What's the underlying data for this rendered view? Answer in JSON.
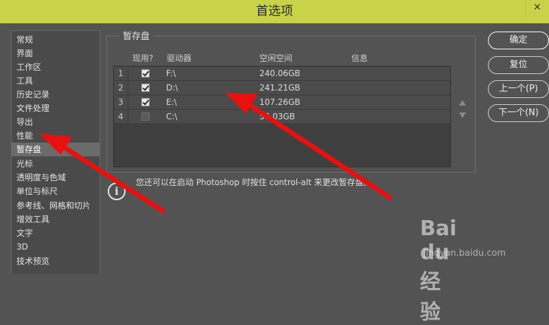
{
  "window": {
    "title": "首选项"
  },
  "sidebar": {
    "items": [
      {
        "label": "常规"
      },
      {
        "label": "界面"
      },
      {
        "label": "工作区"
      },
      {
        "label": "工具"
      },
      {
        "label": "历史记录"
      },
      {
        "label": "文件处理"
      },
      {
        "label": "导出"
      },
      {
        "label": "性能"
      },
      {
        "label": "暂存盘",
        "selected": true
      },
      {
        "label": "光标"
      },
      {
        "label": "透明度与色域"
      },
      {
        "label": "单位与标尺"
      },
      {
        "label": "参考线、网格和切片"
      },
      {
        "label": "增效工具"
      },
      {
        "label": "文字"
      },
      {
        "label": "3D"
      },
      {
        "label": "技术预览"
      }
    ]
  },
  "scratch": {
    "group_label": "暂存盘",
    "columns": {
      "active": "现用?",
      "drive": "驱动器",
      "free": "空闲空间",
      "info": "信息"
    },
    "rows": [
      {
        "num": "1",
        "checked": true,
        "drive": "F:\\",
        "free": "240.06GB"
      },
      {
        "num": "2",
        "checked": true,
        "drive": "D:\\",
        "free": "241.21GB"
      },
      {
        "num": "3",
        "checked": true,
        "drive": "E:\\",
        "free": "107.26GB"
      },
      {
        "num": "4",
        "checked": false,
        "drive": "C:\\",
        "free": "56.03GB"
      }
    ],
    "info_text": "您还可以在启动 Photoshop 时按住 control-alt 来更改暂存盘。"
  },
  "buttons": {
    "ok": "确定",
    "reset": "复位",
    "prev": "上一个(P)",
    "next": "下一个(N)"
  },
  "watermark": {
    "logo": "Bai du 经验",
    "url": "jingyan.baidu.com"
  },
  "colors": {
    "titlebar": "#c8d34a",
    "panel": "#535353",
    "arrow": "#e81010"
  }
}
